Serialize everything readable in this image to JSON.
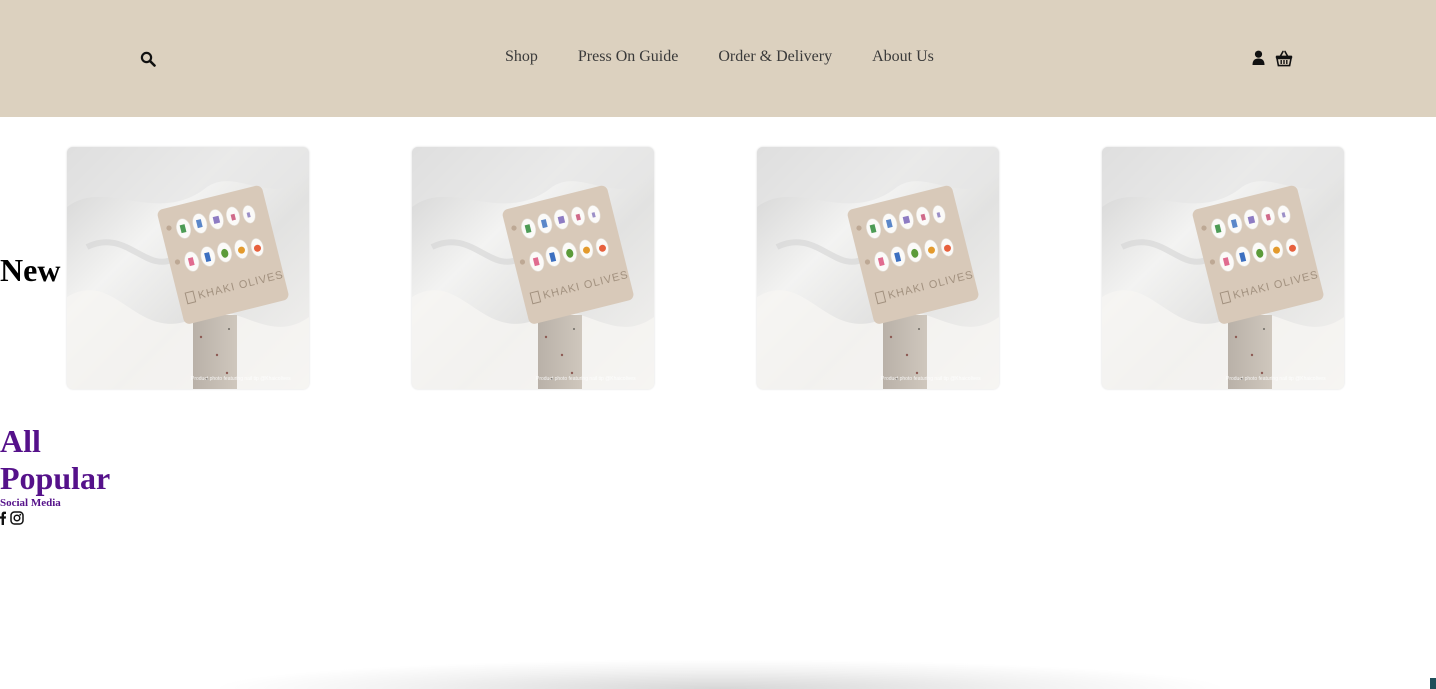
{
  "header": {
    "background": "#dcd1bf",
    "search_icon": "search-icon",
    "nav": [
      {
        "label": "Shop"
      },
      {
        "label": "Press On Guide"
      },
      {
        "label": "Order & Delivery"
      },
      {
        "label": "About Us"
      }
    ],
    "account_icon": "user-icon",
    "cart_icon": "basket-icon"
  },
  "new_section": {
    "title": "New",
    "products": [
      {
        "image_caption": "Product photo featuring nail tip @Khaicolives"
      },
      {
        "image_caption": "Product photo featuring nail tip @Khaicolives"
      },
      {
        "image_caption": "Product photo featuring nail tip @Khaicolives"
      },
      {
        "image_caption": "Product photo featuring nail tip @Khaicolives"
      }
    ]
  },
  "categories": [
    {
      "label": "All"
    },
    {
      "label": "Popular"
    }
  ],
  "social": {
    "label": "Social Media",
    "facebook_icon": "facebook-icon",
    "instagram_icon": "instagram-icon"
  },
  "colors": {
    "accent": "#55118a",
    "header_bg": "#dcd1bf",
    "nav_text": "#3a3a3a"
  }
}
